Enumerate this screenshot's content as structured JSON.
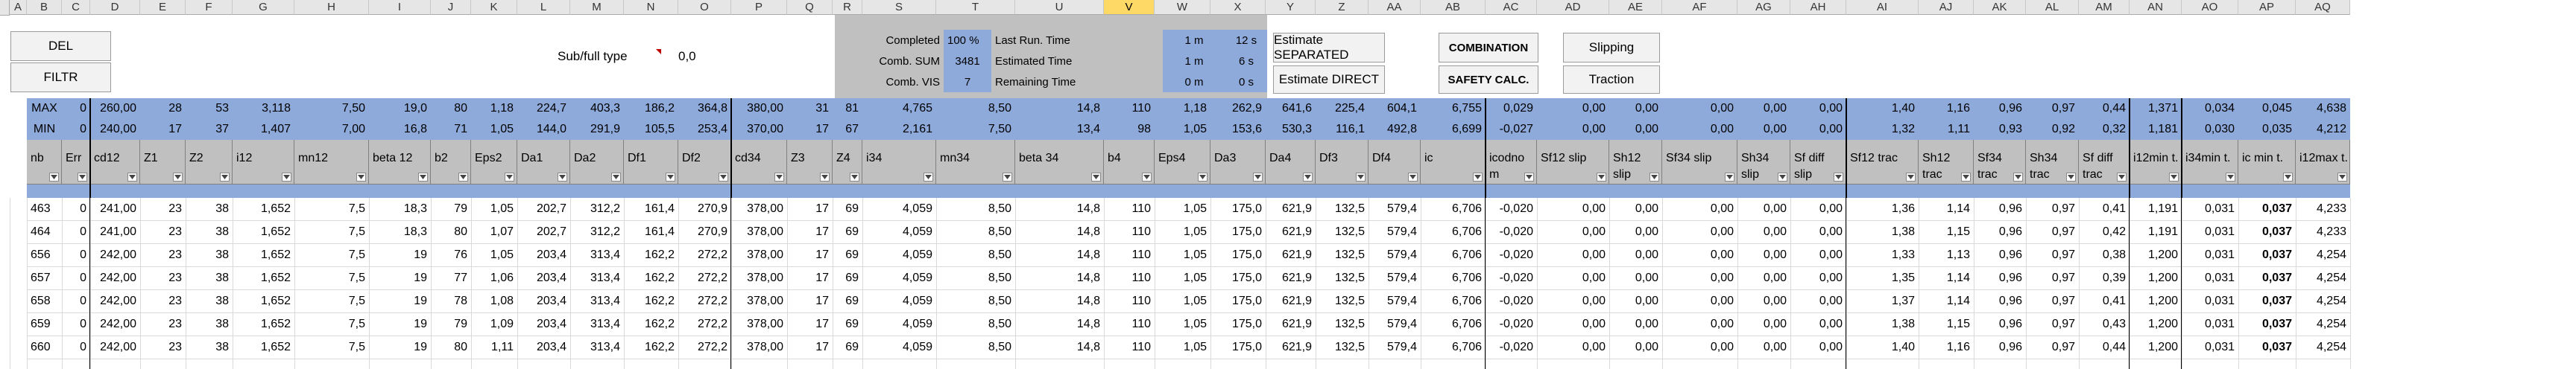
{
  "buttons": {
    "del": "DEL",
    "filtr": "FILTR",
    "estimate_separated": "Estimate SEPARATED",
    "estimate_direct": "Estimate DIRECT",
    "combination": "COMBINATION",
    "safety_calc": "SAFETY CALC.",
    "slipping": "Slipping",
    "traction": "Traction"
  },
  "subfull": {
    "label": "Sub/full type",
    "value": "0,0"
  },
  "status": {
    "completed_label": "Completed",
    "completed_value": "100 %",
    "comb_sum_label": "Comb. SUM",
    "comb_sum_value": "3481",
    "comb_vis_label": "Comb. VIS",
    "comb_vis_value": "7",
    "last_run_label": "Last Run. Time",
    "last_run_m": "1 m",
    "last_run_s": "12 s",
    "estimated_label": "Estimated Time",
    "estimated_m": "1 m",
    "estimated_s": "6 s",
    "remaining_label": "Remaining Time",
    "remaining_m": "0 m",
    "remaining_s": "0 s"
  },
  "columns": [
    "A",
    "B",
    "C",
    "D",
    "E",
    "F",
    "G",
    "H",
    "I",
    "J",
    "K",
    "L",
    "M",
    "N",
    "O",
    "P",
    "Q",
    "R",
    "S",
    "T",
    "U",
    "V",
    "W",
    "X",
    "Y",
    "Z",
    "AA",
    "AB",
    "AC",
    "AD",
    "AE",
    "AF",
    "AG",
    "AH",
    "AI",
    "AJ",
    "AK",
    "AL",
    "AM",
    "AN",
    "AO",
    "AP",
    "AQ"
  ],
  "selected_column": "V",
  "maxmin": {
    "max_label": "MAX",
    "min_label": "MIN",
    "max": [
      "0",
      "260,00",
      "28",
      "53",
      "3,118",
      "7,50",
      "19,0",
      "80",
      "1,18",
      "224,7",
      "403,3",
      "186,2",
      "364,8",
      "380,00",
      "31",
      "81",
      "4,765",
      "8,50",
      "14,8",
      "110",
      "1,18",
      "262,9",
      "641,6",
      "225,4",
      "604,1",
      "6,755",
      "0,029",
      "0,00",
      "0,00",
      "0,00",
      "0,00",
      "0,00",
      "1,40",
      "1,16",
      "0,96",
      "0,97",
      "0,44",
      "1,371",
      "0,034",
      "0,045",
      "4,638"
    ],
    "min": [
      "0",
      "240,00",
      "17",
      "37",
      "1,407",
      "7,00",
      "16,8",
      "71",
      "1,05",
      "144,0",
      "291,9",
      "105,5",
      "253,4",
      "370,00",
      "17",
      "67",
      "2,161",
      "7,50",
      "13,4",
      "98",
      "1,05",
      "153,6",
      "530,3",
      "116,1",
      "492,8",
      "6,699",
      "-0,027",
      "0,00",
      "0,00",
      "0,00",
      "0,00",
      "0,00",
      "1,32",
      "1,11",
      "0,93",
      "0,92",
      "0,32",
      "1,181",
      "0,030",
      "0,035",
      "4,212"
    ]
  },
  "headers": [
    "nb",
    "Err",
    "cd12",
    "Z1",
    "Z2",
    "i12",
    "mn12",
    "beta 12",
    "b2",
    "Eps2",
    "Da1",
    "Da2",
    "Df1",
    "Df2",
    "cd34",
    "Z3",
    "Z4",
    "i34",
    "mn34",
    "beta 34",
    "b4",
    "Eps4",
    "Da3",
    "Da4",
    "Df3",
    "Df4",
    "ic",
    "icodno m",
    "Sf12 slip",
    "Sh12 slip",
    "Sf34 slip",
    "Sh34 slip",
    "Sf diff slip",
    "Sf12 trac",
    "Sh12 trac",
    "Sf34 trac",
    "Sh34 trac",
    "Sf diff trac",
    "i12min t.",
    "i34min t.",
    "ic min t.",
    "i12max t."
  ],
  "rows": [
    [
      "463",
      "0",
      "241,00",
      "23",
      "38",
      "1,652",
      "7,5",
      "18,3",
      "79",
      "1,05",
      "202,7",
      "312,2",
      "161,4",
      "270,9",
      "378,00",
      "17",
      "69",
      "4,059",
      "8,50",
      "14,8",
      "110",
      "1,05",
      "175,0",
      "621,9",
      "132,5",
      "579,4",
      "6,706",
      "-0,020",
      "0,00",
      "0,00",
      "0,00",
      "0,00",
      "0,00",
      "1,36",
      "1,14",
      "0,96",
      "0,97",
      "0,41",
      "1,191",
      "0,031",
      "0,037",
      "4,233"
    ],
    [
      "464",
      "0",
      "241,00",
      "23",
      "38",
      "1,652",
      "7,5",
      "18,3",
      "80",
      "1,07",
      "202,7",
      "312,2",
      "161,4",
      "270,9",
      "378,00",
      "17",
      "69",
      "4,059",
      "8,50",
      "14,8",
      "110",
      "1,05",
      "175,0",
      "621,9",
      "132,5",
      "579,4",
      "6,706",
      "-0,020",
      "0,00",
      "0,00",
      "0,00",
      "0,00",
      "0,00",
      "1,38",
      "1,15",
      "0,96",
      "0,97",
      "0,42",
      "1,191",
      "0,031",
      "0,037",
      "4,233"
    ],
    [
      "656",
      "0",
      "242,00",
      "23",
      "38",
      "1,652",
      "7,5",
      "19",
      "76",
      "1,05",
      "203,4",
      "313,4",
      "162,2",
      "272,2",
      "378,00",
      "17",
      "69",
      "4,059",
      "8,50",
      "14,8",
      "110",
      "1,05",
      "175,0",
      "621,9",
      "132,5",
      "579,4",
      "6,706",
      "-0,020",
      "0,00",
      "0,00",
      "0,00",
      "0,00",
      "0,00",
      "1,33",
      "1,13",
      "0,96",
      "0,97",
      "0,38",
      "1,200",
      "0,031",
      "0,037",
      "4,254"
    ],
    [
      "657",
      "0",
      "242,00",
      "23",
      "38",
      "1,652",
      "7,5",
      "19",
      "77",
      "1,06",
      "203,4",
      "313,4",
      "162,2",
      "272,2",
      "378,00",
      "17",
      "69",
      "4,059",
      "8,50",
      "14,8",
      "110",
      "1,05",
      "175,0",
      "621,9",
      "132,5",
      "579,4",
      "6,706",
      "-0,020",
      "0,00",
      "0,00",
      "0,00",
      "0,00",
      "0,00",
      "1,35",
      "1,14",
      "0,96",
      "0,97",
      "0,39",
      "1,200",
      "0,031",
      "0,037",
      "4,254"
    ],
    [
      "658",
      "0",
      "242,00",
      "23",
      "38",
      "1,652",
      "7,5",
      "19",
      "78",
      "1,08",
      "203,4",
      "313,4",
      "162,2",
      "272,2",
      "378,00",
      "17",
      "69",
      "4,059",
      "8,50",
      "14,8",
      "110",
      "1,05",
      "175,0",
      "621,9",
      "132,5",
      "579,4",
      "6,706",
      "-0,020",
      "0,00",
      "0,00",
      "0,00",
      "0,00",
      "0,00",
      "1,37",
      "1,14",
      "0,96",
      "0,97",
      "0,41",
      "1,200",
      "0,031",
      "0,037",
      "4,254"
    ],
    [
      "659",
      "0",
      "242,00",
      "23",
      "38",
      "1,652",
      "7,5",
      "19",
      "79",
      "1,09",
      "203,4",
      "313,4",
      "162,2",
      "272,2",
      "378,00",
      "17",
      "69",
      "4,059",
      "8,50",
      "14,8",
      "110",
      "1,05",
      "175,0",
      "621,9",
      "132,5",
      "579,4",
      "6,706",
      "-0,020",
      "0,00",
      "0,00",
      "0,00",
      "0,00",
      "0,00",
      "1,38",
      "1,15",
      "0,96",
      "0,97",
      "0,43",
      "1,200",
      "0,031",
      "0,037",
      "4,254"
    ],
    [
      "660",
      "0",
      "242,00",
      "23",
      "38",
      "1,652",
      "7,5",
      "19",
      "80",
      "1,11",
      "203,4",
      "313,4",
      "162,2",
      "272,2",
      "378,00",
      "17",
      "69",
      "4,059",
      "8,50",
      "14,8",
      "110",
      "1,05",
      "175,0",
      "621,9",
      "132,5",
      "579,4",
      "6,706",
      "-0,020",
      "0,00",
      "0,00",
      "0,00",
      "0,00",
      "0,00",
      "1,40",
      "1,16",
      "0,96",
      "0,97",
      "0,44",
      "1,200",
      "0,031",
      "0,037",
      "4,254"
    ]
  ],
  "bold_column": "ic min t.",
  "colors": {
    "grey_band": "#c0c0c0",
    "blue_band": "#8eaadb",
    "selected_header": "#ffd966",
    "grid": "#d9d9d9"
  }
}
